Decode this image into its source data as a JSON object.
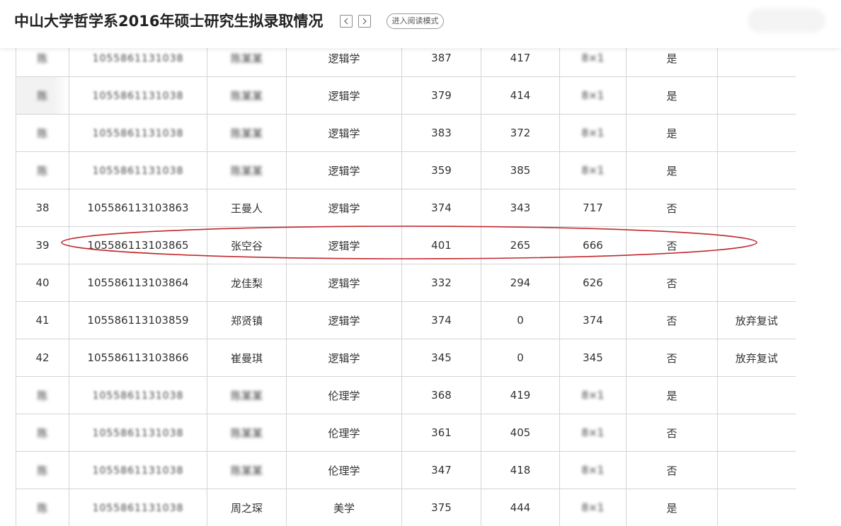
{
  "header": {
    "title": "中山大学哲学系2016年硕士研究生拟录取情况",
    "prev_label": "<",
    "next_label": ">",
    "reader_mode_label": "进入阅读模式"
  },
  "colors": {
    "highlight_oval": "#c0282d",
    "grid": "#d4d4d4"
  },
  "table": {
    "rows": [
      {
        "no": "",
        "id": "",
        "name": "",
        "major": "逻辑学",
        "prelim": "387",
        "retest": "417",
        "total": "",
        "admit": "是",
        "note": "",
        "blurred": true
      },
      {
        "no": "",
        "id": "",
        "name": "",
        "major": "逻辑学",
        "prelim": "379",
        "retest": "414",
        "total": "",
        "admit": "是",
        "note": "",
        "blurred": true
      },
      {
        "no": "",
        "id": "",
        "name": "",
        "major": "逻辑学",
        "prelim": "383",
        "retest": "372",
        "total": "",
        "admit": "是",
        "note": "",
        "blurred": true
      },
      {
        "no": "",
        "id": "",
        "name": "",
        "major": "逻辑学",
        "prelim": "359",
        "retest": "385",
        "total": "",
        "admit": "是",
        "note": "",
        "blurred": true
      },
      {
        "no": "38",
        "id": "105586113103863",
        "name": "王曼人",
        "major": "逻辑学",
        "prelim": "374",
        "retest": "343",
        "total": "717",
        "admit": "否",
        "note": "",
        "blurred": false
      },
      {
        "no": "39",
        "id": "105586113103865",
        "name": "张空谷",
        "major": "逻辑学",
        "prelim": "401",
        "retest": "265",
        "total": "666",
        "admit": "否",
        "note": "",
        "blurred": false,
        "highlighted": true
      },
      {
        "no": "40",
        "id": "105586113103864",
        "name": "龙佳梨",
        "major": "逻辑学",
        "prelim": "332",
        "retest": "294",
        "total": "626",
        "admit": "否",
        "note": "",
        "blurred": false
      },
      {
        "no": "41",
        "id": "105586113103859",
        "name": "郑贤镇",
        "major": "逻辑学",
        "prelim": "374",
        "retest": "0",
        "total": "374",
        "admit": "否",
        "note": "放弃复试",
        "blurred": false
      },
      {
        "no": "42",
        "id": "105586113103866",
        "name": "崔曼琪",
        "major": "逻辑学",
        "prelim": "345",
        "retest": "0",
        "total": "345",
        "admit": "否",
        "note": "放弃复试",
        "blurred": false
      },
      {
        "no": "",
        "id": "",
        "name": "",
        "major": "伦理学",
        "prelim": "368",
        "retest": "419",
        "total": "",
        "admit": "是",
        "note": "",
        "blurred": true
      },
      {
        "no": "",
        "id": "",
        "name": "",
        "major": "伦理学",
        "prelim": "361",
        "retest": "405",
        "total": "",
        "admit": "否",
        "note": "",
        "blurred": true
      },
      {
        "no": "",
        "id": "",
        "name": "",
        "major": "伦理学",
        "prelim": "347",
        "retest": "418",
        "total": "",
        "admit": "否",
        "note": "",
        "blurred": true
      },
      {
        "no": "",
        "id": "",
        "name": "周之琛",
        "major": "美学",
        "prelim": "375",
        "retest": "444",
        "total": "",
        "admit": "是",
        "note": "",
        "blurred": true
      }
    ]
  }
}
